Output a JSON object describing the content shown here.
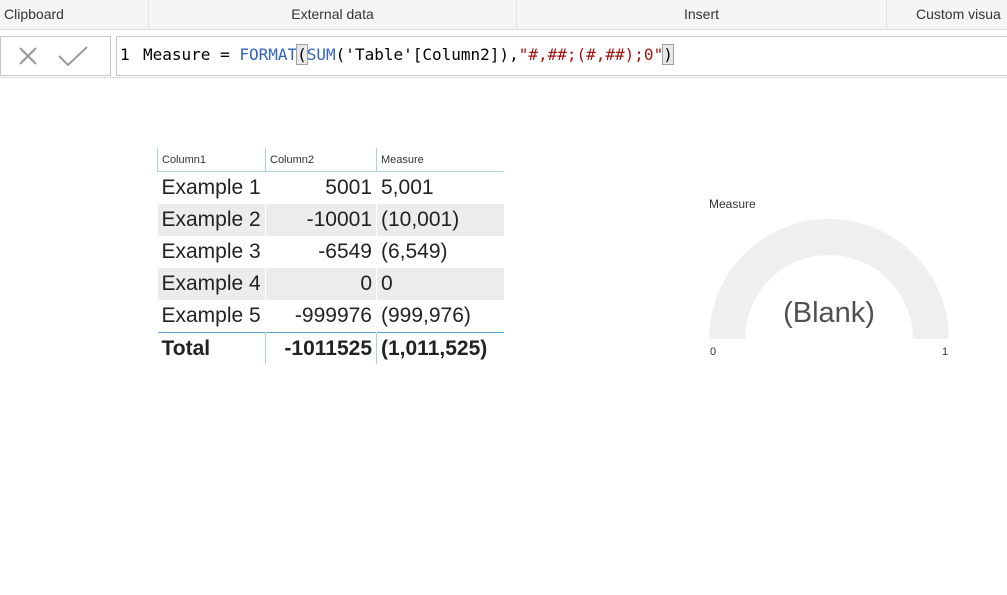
{
  "ribbon": {
    "groups": [
      {
        "label": "Clipboard"
      },
      {
        "label": "External data"
      },
      {
        "label": "Insert"
      },
      {
        "label": "Custom visua"
      }
    ]
  },
  "formula_bar": {
    "line_number": "1",
    "tokens": [
      {
        "text": "Measure = ",
        "kind": "plain"
      },
      {
        "text": "FORMAT",
        "kind": "fn"
      },
      {
        "text": "(",
        "kind": "paren-hl"
      },
      {
        "text": "SUM",
        "kind": "fn"
      },
      {
        "text": "('Table'[Column2]),",
        "kind": "plain"
      },
      {
        "text": "\"#,##;(#,##);0\"",
        "kind": "str"
      },
      {
        "text": ")",
        "kind": "paren-hl"
      }
    ],
    "cancel_icon": "close-icon",
    "commit_icon": "checkmark-icon"
  },
  "table": {
    "headers": [
      "Column1",
      "Column2",
      "Measure"
    ],
    "rows": [
      [
        "Example 1",
        "5001",
        "5,001"
      ],
      [
        "Example 2",
        "-10001",
        "(10,001)"
      ],
      [
        "Example 3",
        "-6549",
        "(6,549)"
      ],
      [
        "Example 4",
        "0",
        "0"
      ],
      [
        "Example 5",
        "-999976",
        "(999,976)"
      ]
    ],
    "total": [
      "Total",
      "-1011525",
      "(1,011,525)"
    ]
  },
  "gauge": {
    "title": "Measure",
    "value_text": "(Blank)",
    "min": "0",
    "max": "1",
    "value_fraction": 0,
    "track_color": "#f0efef"
  }
}
